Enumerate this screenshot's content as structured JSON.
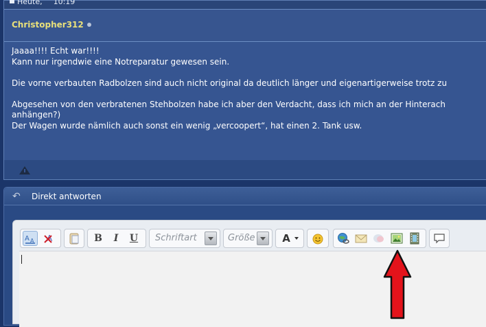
{
  "post": {
    "date_label": "Heute,",
    "time": "10:19",
    "username": "Christopher312",
    "lines": [
      "Jaaaa!!!! Echt war!!!!",
      "Kann nur irgendwie eine Notreparatur gewesen sein.",
      "",
      "Die vorne verbauten Radbolzen sind auch nicht original da deutlich länger und eigenartigerweise trotz zu",
      "",
      "Abgesehen von den verbratenen Stehbolzen habe ich aber den Verdacht, dass ich mich an der Hinterach",
      "anhängen?)",
      "Der Wagen wurde nämlich auch sonst ein wenig „vercoopert“, hat einen 2. Tank usw."
    ]
  },
  "reply": {
    "title": "Direkt antworten"
  },
  "toolbar": {
    "font_placeholder": "Schriftart",
    "size_placeholder": "Größe",
    "bold": "B",
    "italic": "I",
    "underline": "U",
    "font_color": "A"
  },
  "colors": {
    "username": "#e9e07a",
    "annotation_arrow": "#e3131b"
  }
}
